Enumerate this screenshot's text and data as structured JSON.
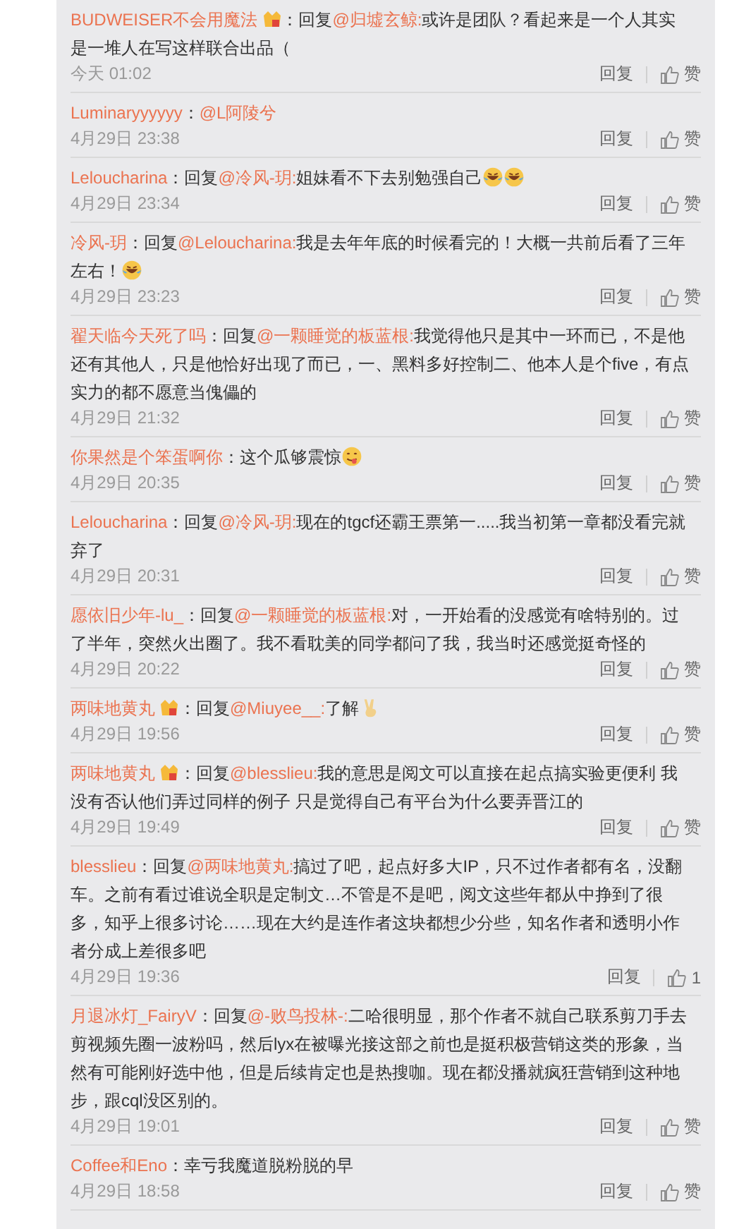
{
  "comments": [
    {
      "user": "BUDWEISER不会用魔法",
      "badge": true,
      "separator": "：",
      "prefix": "回复",
      "mention": "@归墟玄鲸:",
      "text": "或许是团队？看起来是一个人其实是一堆人在写这样联合出品（",
      "time": "今天 01:02",
      "reply": "回复",
      "like": "赞"
    },
    {
      "user": "Luminaryyyyyy",
      "badge": false,
      "separator": "：",
      "mention": "@L阿陵兮",
      "time": "4月29日 23:38",
      "reply": "回复",
      "like": "赞"
    },
    {
      "user": "Leloucharina",
      "badge": false,
      "separator": "：",
      "prefix": "回复",
      "mention": "@冷风-玥:",
      "text": "姐妹看不下去别勉强自己",
      "emojis": [
        {
          "kind": "laugh-cry"
        },
        {
          "kind": "laugh-cry"
        }
      ],
      "time": "4月29日 23:34",
      "reply": "回复",
      "like": "赞"
    },
    {
      "user": "冷风-玥",
      "badge": false,
      "separator": "：",
      "prefix": "回复",
      "mention": "@Leloucharina:",
      "text": "我是去年年底的时候看完的！大概一共前后看了三年左右！",
      "emojis": [
        {
          "kind": "laugh-cry"
        }
      ],
      "time": "4月29日 23:23",
      "reply": "回复",
      "like": "赞"
    },
    {
      "user": "翟天临今天死了吗",
      "badge": false,
      "separator": "：",
      "prefix": "回复",
      "mention": "@一颗睡觉的板蓝根:",
      "text": "我觉得他只是其中一环而已，不是他还有其他人，只是他恰好出现了而已，一、黑料多好控制二、他本人是个five，有点实力的都不愿意当傀儡的",
      "time": "4月29日 21:32",
      "reply": "回复",
      "like": "赞"
    },
    {
      "user": "你果然是个笨蛋啊你",
      "badge": false,
      "separator": "：",
      "text": "这个瓜够震惊",
      "emojis": [
        {
          "kind": "yum"
        }
      ],
      "time": "4月29日 20:35",
      "reply": "回复",
      "like": "赞"
    },
    {
      "user": "Leloucharina",
      "badge": false,
      "separator": "：",
      "prefix": "回复",
      "mention": "@冷风-玥:",
      "text": "现在的tgcf还霸王票第一.....我当初第一章都没看完就弃了",
      "time": "4月29日 20:31",
      "reply": "回复",
      "like": "赞"
    },
    {
      "user": "愿依旧少年-lu_",
      "badge": false,
      "separator": "：",
      "prefix": "回复",
      "mention": "@一颗睡觉的板蓝根:",
      "text": "对，一开始看的没感觉有啥特别的。过了半年，突然火出圈了。我不看耽美的同学都问了我，我当时还感觉挺奇怪的",
      "time": "4月29日 20:22",
      "reply": "回复",
      "like": "赞"
    },
    {
      "user": "两味地黄丸",
      "badge": true,
      "separator": "：",
      "prefix": "回复",
      "mention": "@Miuyee__:",
      "text": "了解",
      "emojis": [
        {
          "kind": "victory-hand"
        }
      ],
      "time": "4月29日 19:56",
      "reply": "回复",
      "like": "赞"
    },
    {
      "user": "两味地黄丸",
      "badge": true,
      "separator": "：",
      "prefix": "回复",
      "mention": "@blesslieu:",
      "text": "我的意思是阅文可以直接在起点搞实验更便利 我没有否认他们弄过同样的例子 只是觉得自己有平台为什么要弄晋江的",
      "time": "4月29日 19:49",
      "reply": "回复",
      "like": "赞"
    },
    {
      "user": "blesslieu",
      "badge": false,
      "separator": "：",
      "prefix": "回复",
      "mention": "@两味地黄丸:",
      "text": "搞过了吧，起点好多大IP，只不过作者都有名，没翻车。之前有看过谁说全职是定制文…不管是不是吧，阅文这些年都从中挣到了很多，知乎上很多讨论……现在大约是连作者这块都想少分些，知名作者和透明小作者分成上差很多吧",
      "time": "4月29日 19:36",
      "reply": "回复",
      "like": "1"
    },
    {
      "user": "月退冰灯_FairyV",
      "badge": false,
      "separator": "：",
      "prefix": "回复",
      "mention": "@-败鸟投林-:",
      "text": "二哈很明显，那个作者不就自己联系剪刀手去剪视频先圈一波粉吗，然后lyx在被曝光接这部之前也是挺积极营销这类的形象，当然有可能刚好选中他，但是后续肯定也是热搜咖。现在都没播就疯狂营销到这种地步，跟cql没区别的。",
      "time": "4月29日 19:01",
      "reply": "回复",
      "like": "赞"
    },
    {
      "user": "Coffee和Eno",
      "badge": false,
      "separator": "：",
      "text": "幸亏我魔道脱粉脱的早",
      "time": "4月29日 18:58",
      "reply": "回复",
      "like": "赞"
    }
  ]
}
